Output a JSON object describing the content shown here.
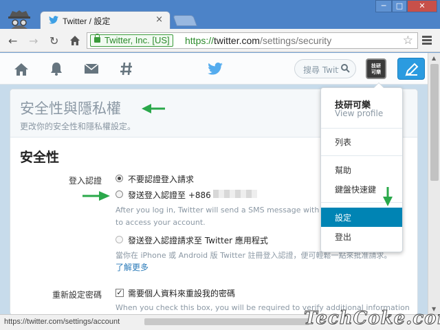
{
  "browser": {
    "tab_title": "Twitter / 設定",
    "tab_close": "×",
    "ev_label": "Twitter, Inc. [US]",
    "url_scheme": "https://",
    "url_host": "twitter.com",
    "url_path": "/settings/security",
    "status_url": "https://twitter.com/settings/account",
    "window_min": "─",
    "window_max": "□",
    "window_close": "✕"
  },
  "twitter_nav": {
    "search_placeholder": "搜尋 Twitter",
    "avatar_text": "技研\n可樂"
  },
  "page": {
    "header_title": "安全性與隱私權",
    "header_subtitle": "更改你的安全性和隱私權設定。",
    "section_title": "安全性",
    "login_verify_label": "登入認證",
    "option_no_verify": "不要認證登入請求",
    "option_send_sms": "發送登入認證至 +886",
    "sms_help_1": "After you log in, Twitter will send a SMS message with a",
    "sms_help_2": "to access your account.",
    "option_send_app": "發送登入認證請求至 Twitter 應用程式",
    "app_help": "當你在 iPhone 或 Android 版 Twitter 註冊登入認證，便可輕鬆一點來批准請求。",
    "learn_more": "了解更多",
    "reset_password_label": "重新設定密碼",
    "reset_password_option": "需要個人資料來重設我的密碼",
    "reset_help": "When you check this box, you will be required to verify additional information"
  },
  "dropdown": {
    "name": "技研可樂",
    "view_profile": "View profile",
    "items": [
      "列表",
      "幫助",
      "鍵盤快速鍵",
      "設定",
      "登出"
    ],
    "active": "設定"
  },
  "watermark": "TechCoke.com",
  "colors": {
    "accent": "#0084b4",
    "twitter_blue": "#2b9be0",
    "arrow_green": "#2aa84a"
  }
}
